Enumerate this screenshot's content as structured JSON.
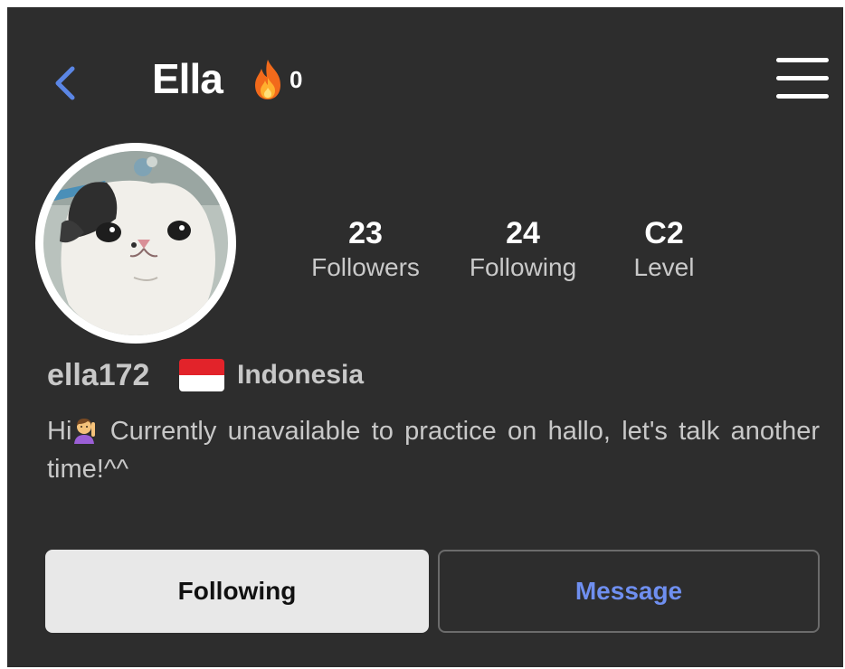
{
  "header": {
    "title": "Ella",
    "streak_count": "0",
    "icons": {
      "back": "chevron-left-icon",
      "streak": "fire-icon",
      "menu": "hamburger-menu-icon"
    }
  },
  "profile": {
    "avatar_icon": "cat-avatar-icon",
    "stats": [
      {
        "value": "23",
        "label": "Followers"
      },
      {
        "value": "24",
        "label": "Following"
      },
      {
        "value": "C2",
        "label": "Level"
      }
    ],
    "username": "ella172",
    "country": "Indonesia",
    "flag_icon": "indonesia-flag-icon",
    "bio_before": "Hi",
    "bio_emoji_icon": "person-raising-hand-emoji",
    "bio_after": " Currently unavailable to practice on hallo, let's talk another time!^^"
  },
  "actions": {
    "following_label": "Following",
    "message_label": "Message"
  },
  "colors": {
    "background": "#2d2d2d",
    "accent": "#6f8ff0",
    "back_arrow": "#5b86e5",
    "text_muted": "#c8c8c8"
  }
}
